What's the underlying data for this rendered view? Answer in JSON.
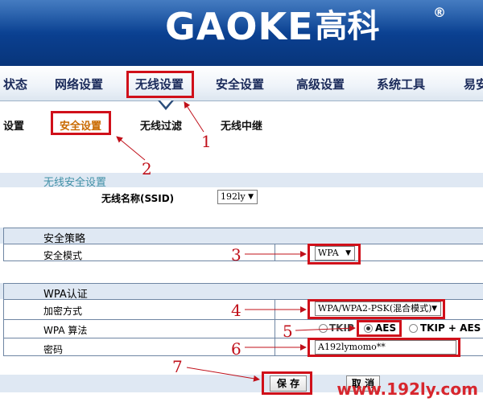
{
  "brand": {
    "latin": "GAOKE",
    "cjk": "高科",
    "reg": "®"
  },
  "main_nav": [
    "状态",
    "网络设置",
    "无线设置",
    "安全设置",
    "高级设置",
    "系统工具",
    "易安"
  ],
  "sub_nav": {
    "left": "设置",
    "security": "安全设置",
    "filter": "无线过滤",
    "relay": "无线中继"
  },
  "wireless_security": {
    "title": "无线安全设置",
    "ssid_label": "无线名称(SSID)",
    "ssid_value": "192ly"
  },
  "policy": {
    "title": "安全策略",
    "mode_label": "安全模式",
    "mode_value": "WPA"
  },
  "wpa": {
    "title": "WPA认证",
    "encryption_label": "加密方式",
    "encryption_value": "WPA/WPA2-PSK(混合模式)",
    "algorithm_label": "WPA 算法",
    "algo_options": [
      "TKIP",
      "AES",
      "TKIP + AES"
    ],
    "algo_selected": "AES",
    "password_label": "密码",
    "password_value": "A192lymomo**"
  },
  "buttons": {
    "save": "保 存",
    "cancel": "取 消"
  },
  "annotations": [
    "1",
    "2",
    "3",
    "4",
    "5",
    "6",
    "7"
  ],
  "watermark": "www.192ly.com",
  "colors": {
    "accent_red": "#d0101a",
    "header_blue": "#0a3f8f",
    "band": "#dfe8f3",
    "active_sub": "#c96a00"
  }
}
